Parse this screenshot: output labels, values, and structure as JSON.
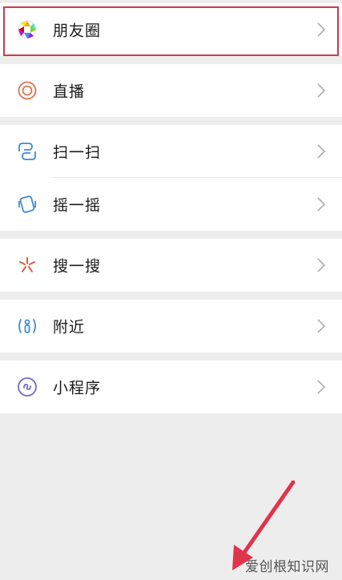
{
  "menu": {
    "moments": "朋友圈",
    "live": "直播",
    "scan": "扫一扫",
    "shake": "摇一摇",
    "search": "搜一搜",
    "nearby": "附近",
    "mini_programs": "小程序"
  },
  "icons": {
    "moments": "moments-aperture-icon",
    "live": "live-ring-icon",
    "scan": "scan-icon",
    "shake": "shake-icon",
    "search": "search-sparkle-icon",
    "nearby": "nearby-person-icon",
    "mini_programs": "mini-program-icon",
    "chevron": "chevron-right-icon"
  },
  "colors": {
    "highlight_border": "#d6374b",
    "arrow": "#e0344c",
    "chevron": "#b2b2b2",
    "background": "#ededed"
  },
  "watermark": "爱创根知识网"
}
